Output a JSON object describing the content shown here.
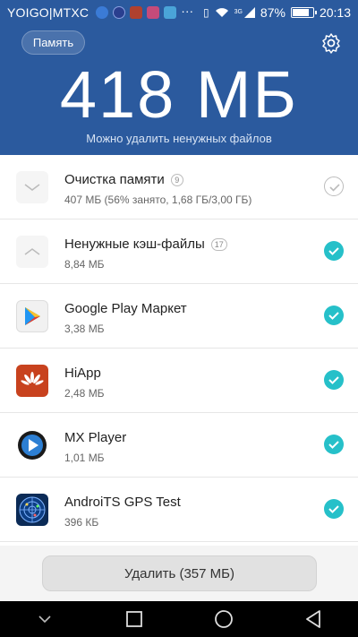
{
  "status_bar": {
    "carrier": "YOIGO|MTXC",
    "network": "3G",
    "battery_percent": "87%",
    "battery_level": 0.87,
    "time": "20:13",
    "icons": [
      "shield-icon",
      "browser-icon",
      "game-icon",
      "photo-icon",
      "more-icon",
      "vibrate-icon",
      "wifi-icon",
      "signal-icon",
      "battery-icon"
    ]
  },
  "header": {
    "memory_button": "Память",
    "size": "418 МБ",
    "subtitle": "Можно удалить ненужных файлов",
    "bg_color": "#2b5a9e"
  },
  "list": [
    {
      "title": "Очистка памяти",
      "count": "9",
      "sub": "407 МБ (56% занято, 1,68 ГБ/3,00 ГБ)",
      "checked": false,
      "icon": "chevron-down-icon"
    },
    {
      "title": "Ненужные кэш-файлы",
      "count": "17",
      "sub": "8,84 МБ",
      "checked": true,
      "icon": "chevron-up-icon"
    },
    {
      "title": "Google Play Маркет",
      "sub": "3,38 МБ",
      "checked": true,
      "icon": "google-play-icon"
    },
    {
      "title": "HiApp",
      "sub": "2,48 МБ",
      "checked": true,
      "icon": "hiapp-icon"
    },
    {
      "title": "MX Player",
      "sub": "1,01 МБ",
      "checked": true,
      "icon": "mx-player-icon"
    },
    {
      "title": "AndroiTS GPS Test",
      "sub": "396 КБ",
      "checked": true,
      "icon": "gps-test-icon"
    }
  ],
  "delete_button": "Удалить (357 МБ)",
  "colors": {
    "accent": "#26c0c9"
  },
  "navbar": {
    "icons": [
      "hide-keyboard-icon",
      "recents-icon",
      "home-icon",
      "back-icon"
    ]
  }
}
